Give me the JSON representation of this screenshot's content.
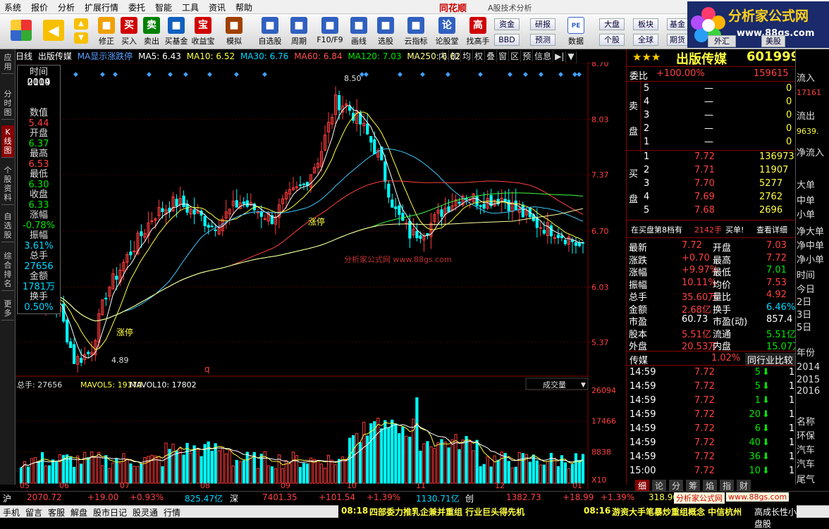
{
  "menu": [
    "系统",
    "报价",
    "分析",
    "扩展行情",
    "委托",
    "智能",
    "工具",
    "资讯",
    "帮助"
  ],
  "brand": "同花顺",
  "window_title": "A股技术分析",
  "toolbar": [
    {
      "label": "修正",
      "icon": "fix-icon",
      "color": "#f0a000"
    },
    {
      "label": "买入",
      "icon": "buy-icon",
      "color": "#d00000",
      "glyph": "买"
    },
    {
      "label": "卖出",
      "icon": "sell-icon",
      "color": "#008000",
      "glyph": "卖"
    },
    {
      "label": "买基金",
      "icon": "fund-icon",
      "color": "#1060c0"
    },
    {
      "label": "收益宝",
      "icon": "treasure-icon",
      "color": "#d00000",
      "glyph": "宝"
    },
    {
      "label": "模拟",
      "icon": "hammer-icon",
      "color": "#a04000"
    },
    {
      "label": "自选股",
      "icon": "star-icon",
      "color": "#3060c0"
    },
    {
      "label": "周期",
      "icon": "clock-icon",
      "color": "#3060c0"
    },
    {
      "label": "F10/F9",
      "icon": "f10-icon",
      "color": "#3060c0"
    },
    {
      "label": "画线",
      "icon": "pen-icon",
      "color": "#3060c0"
    },
    {
      "label": "选股",
      "icon": "select-icon",
      "color": "#3060c0"
    },
    {
      "label": "云指标",
      "icon": "cloud-icon",
      "color": "#3060c0"
    },
    {
      "label": "论股堂",
      "icon": "discuss-icon",
      "color": "#3060c0",
      "glyph": "论"
    },
    {
      "label": "找高手",
      "icon": "expert-icon",
      "color": "#d00000",
      "glyph": "高"
    }
  ],
  "toolbar_small": [
    "资金",
    "研报",
    "BBD",
    "预测",
    "数据",
    "大盘",
    "板块",
    "基金",
    "个股",
    "全球",
    "期货",
    "外汇",
    "美股"
  ],
  "logo": {
    "title": "分析家公式网",
    "url": "www.88gs.com"
  },
  "left_nav": [
    "应用",
    "分时图",
    "K线图",
    "个股资料",
    "自选股",
    "综合排名",
    "更多"
  ],
  "chart_header": {
    "period": "日线",
    "stock": "出版传媒",
    "ma_label": "MA显示涨跌停",
    "ma5": "MA5: 6.43",
    "ma10": "MA10: 6.52",
    "ma30": "MA30: 6.76",
    "ma60": "MA60: 6.84",
    "ma120": "MA120: 7.03",
    "ma250": "MA250: 6.62"
  },
  "chart_buttons": [
    "内",
    "加",
    "均",
    "权",
    "叠",
    "窗",
    "区",
    "预",
    "信息"
  ],
  "info_box": [
    {
      "label": "时间",
      "value": "2014"
    },
    {
      "label": "",
      "value": "0109"
    },
    {
      "label": "数值",
      "value": "5.44",
      "color": "#ff4040"
    },
    {
      "label": "开盘",
      "value": "6.37",
      "color": "#00e600"
    },
    {
      "label": "最高",
      "value": "6.53",
      "color": "#ff4040"
    },
    {
      "label": "最低",
      "value": "6.30",
      "color": "#00e600"
    },
    {
      "label": "收盘",
      "value": "6.33",
      "color": "#00e600"
    },
    {
      "label": "涨幅",
      "value": "-0.78%",
      "color": "#00e600"
    },
    {
      "label": "振幅",
      "value": "3.61%",
      "color": "#00d8ff"
    },
    {
      "label": "总手",
      "value": "27656",
      "color": "#00d8ff"
    },
    {
      "label": "金额",
      "value": "1781万",
      "color": "#00d8ff"
    },
    {
      "label": "换手",
      "value": "0.50%",
      "color": "#00d8ff"
    }
  ],
  "chart_data": [
    {
      "type": "candlestick",
      "price_axis": [
        "8.70",
        "8.03",
        "7.37",
        "6.70",
        "6.03",
        "5.37"
      ],
      "ylim": [
        5.0,
        8.7
      ],
      "annotations": [
        "8.50",
        "4.89",
        "涨停",
        "涨停",
        "q"
      ],
      "month_ticks": [
        "05",
        "06",
        "07",
        "08",
        "09",
        "10",
        "11",
        "12",
        "01"
      ],
      "watermark": "分析家公式网  www.88gs.com",
      "ma_lines": [
        "MA5",
        "MA10",
        "MA30",
        "MA60",
        "MA120",
        "MA250"
      ]
    },
    {
      "type": "bar",
      "title": "总手: 27656",
      "mavol5": "MAVOL5: 19170",
      "mavol10": "MAVOL10: 17802",
      "volume_axis": [
        "26094",
        "17466",
        "8838"
      ],
      "unit": "X10",
      "indicator_select": "成交量"
    }
  ],
  "quote": {
    "name": "出版传媒",
    "code": "601999",
    "weibi_label": "委比",
    "weibi": "+100.00%",
    "weicha": "159615",
    "sell_label": "卖盘",
    "buy_label": "买盘",
    "sell": [
      {
        "lv": "5",
        "p": "—",
        "v": "0"
      },
      {
        "lv": "4",
        "p": "—",
        "v": "0"
      },
      {
        "lv": "3",
        "p": "—",
        "v": "0"
      },
      {
        "lv": "2",
        "p": "—",
        "v": "0"
      },
      {
        "lv": "1",
        "p": "—",
        "v": "0"
      }
    ],
    "buy": [
      {
        "lv": "1",
        "p": "7.72",
        "v": "136973"
      },
      {
        "lv": "2",
        "p": "7.71",
        "v": "11907"
      },
      {
        "lv": "3",
        "p": "7.70",
        "v": "5277"
      },
      {
        "lv": "4",
        "p": "7.69",
        "v": "2762"
      },
      {
        "lv": "5",
        "p": "7.68",
        "v": "2696"
      }
    ],
    "queue_text": "在买盘第8档有",
    "queue_vol": "2142手",
    "queue_buy": "买单!",
    "queue_more": "查看详细",
    "stats": [
      [
        "最新",
        "7.72",
        "开盘",
        "7.03"
      ],
      [
        "涨跌",
        "+0.70",
        "最高",
        "7.72"
      ],
      [
        "涨幅",
        "+9.97%",
        "最低",
        "7.01"
      ],
      [
        "振幅",
        "10.11%",
        "均价",
        "7.53"
      ],
      [
        "总手",
        "35.60万",
        "量比",
        "4.92"
      ],
      [
        "金额",
        "2.68亿",
        "换手",
        "6.46%"
      ],
      [
        "市盈",
        "60.73",
        "市盈(动)",
        "857.4"
      ],
      [
        "股本",
        "5.51亿",
        "流通",
        "5.51亿"
      ],
      [
        "外盘",
        "20.53万",
        "内盘",
        "15.07万"
      ]
    ],
    "sector": "传媒",
    "sector_pct": "1.02%",
    "sector_compare": "同行业比较",
    "ticks": [
      {
        "t": "14:59",
        "p": "7.72",
        "v": "5"
      },
      {
        "t": "14:59",
        "p": "7.72",
        "v": "5"
      },
      {
        "t": "14:59",
        "p": "7.72",
        "v": "1"
      },
      {
        "t": "14:59",
        "p": "7.72",
        "v": "20"
      },
      {
        "t": "14:59",
        "p": "7.72",
        "v": "6"
      },
      {
        "t": "14:59",
        "p": "7.72",
        "v": "40"
      },
      {
        "t": "14:59",
        "p": "7.72",
        "v": "36"
      },
      {
        "t": "15:00",
        "p": "7.72",
        "v": "10"
      }
    ],
    "tabs": [
      "细",
      "论",
      "分",
      "筹",
      "焰",
      "指",
      "财"
    ]
  },
  "far_right": [
    "流入",
    "17161",
    "流出",
    "9639.",
    "净流入",
    "大单",
    "中单",
    "小单",
    "净大单",
    "净中单",
    "净小单",
    "时间",
    "今日",
    "2日",
    "3日",
    "5日",
    "年份",
    "2014",
    "2015",
    "2016",
    "名称",
    "环保",
    "汽车",
    "汽车",
    "尾气"
  ],
  "status": {
    "sh_label": "沪",
    "sh_index": "2070.72",
    "sh_chg": "+19.00",
    "sh_pct": "+0.93%",
    "sh_amt": "825.47亿",
    "sz_label": "深",
    "sz_index": "7401.35",
    "sz_chg": "+101.54",
    "sz_pct": "+1.39%",
    "sz_amt": "1130.71亿",
    "cy_label": "创",
    "cy_index": "1382.73",
    "cy_chg": "+18.99",
    "cy_pct": "+1.39%",
    "extra": "318.90"
  },
  "bottom_links": [
    "手机",
    "留言",
    "客服",
    "解盘",
    "股市日记",
    "股灵通",
    "行情"
  ],
  "news": [
    {
      "time": "08:18",
      "text": "四部委力推乳企兼并重组 行业巨头得先机"
    },
    {
      "time": "08:16",
      "text": "游资大手笔暴炒重组概念 中信杭州"
    }
  ],
  "news_tail": "高成长性小盘股"
}
